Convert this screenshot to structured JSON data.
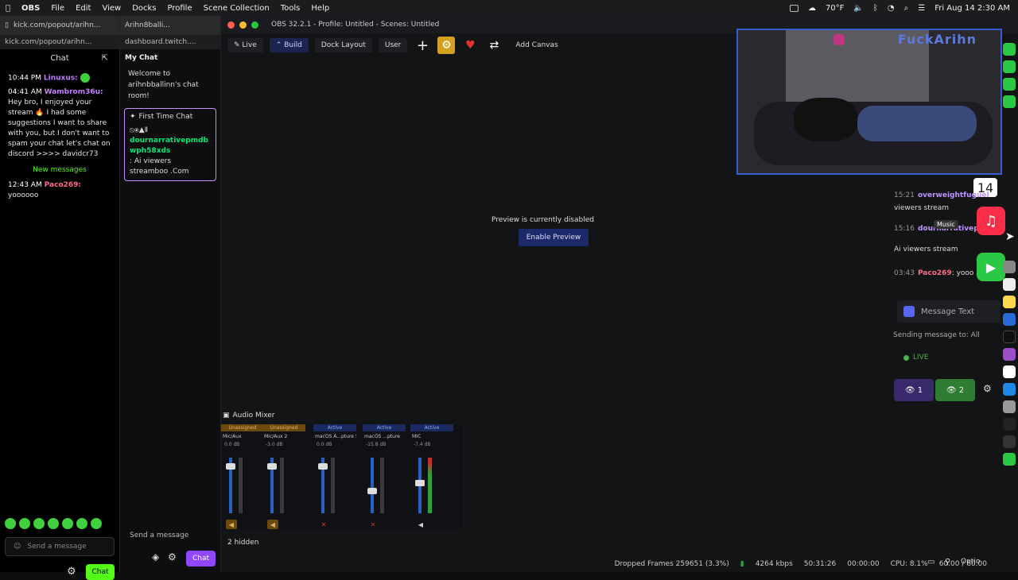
{
  "menubar": {
    "app": "OBS",
    "items": [
      "File",
      "Edit",
      "View",
      "Docks",
      "Profile",
      "Scene Collection",
      "Tools",
      "Help"
    ],
    "weather": "70°F",
    "datetime": "Fri Aug 14  2:30 AM"
  },
  "kick": {
    "tab": "kick.com/popout/arihn...",
    "address": "kick.com/popout/arihn...",
    "chat_title": "Chat",
    "messages": [
      {
        "time": "10:44 PM",
        "user": "Linuxus:",
        "text": ""
      },
      {
        "time": "04:41 AM",
        "user": "Wambrom36u:",
        "text": "Hey bro, I enjoyed your stream 🔥 I had some suggestions I want to share with you, but I don't want to spam your chat let's chat on discord >>>> davidcr73"
      },
      {
        "time": "12:43 AM",
        "user": "Paco269:",
        "text": "yoooooo"
      }
    ],
    "new_messages": "New messages",
    "input_placeholder": "Send a message",
    "chat_button": "Chat"
  },
  "twitch": {
    "tab": "Arihn8balli...",
    "address": "dashboard.twitch....",
    "title": "My Chat",
    "welcome": "Welcome to arihnbballinn's chat room!",
    "first_time": "First Time Chat",
    "ftc_symbols": "⦸⦿▲Ⅱ",
    "ftc_user": "dournarrativepmdbwph58xds",
    "ftc_text": ": Ai viewers streamboo .Com",
    "input_placeholder": "Send a message",
    "chat_button": "Chat"
  },
  "obs": {
    "title": "OBS 32.2.1 - Profile: Untitled - Scenes: Untitled",
    "toolbar": {
      "live": "Live",
      "build": "Build",
      "dock_layout": "Dock Layout",
      "user": "User",
      "add_canvas": "Add Canvas"
    },
    "preview_disabled": "Preview is currently disabled",
    "enable_preview": "Enable Preview",
    "cam_brand": "FuckArihn",
    "side_chat": [
      {
        "time": "15:21",
        "user": "overweightfuguel",
        "text": ""
      },
      {
        "time": "",
        "user": "",
        "text": "viewers stream"
      },
      {
        "time": "15:16",
        "user": "dournarrativep",
        "text": ""
      },
      {
        "time": "",
        "user": "",
        "text": "Ai viewers stream"
      },
      {
        "time": "03:43",
        "user": "Paco269",
        "text": ": yooo"
      }
    ],
    "music_label": "Music",
    "date_badge": "14",
    "message_placeholder": "Message Text",
    "sending_to": "Sending message to: All",
    "live_label": "LIVE",
    "viewers_a": "1",
    "viewers_b": "2",
    "mixer_title": "Audio Mixer",
    "channels": [
      {
        "status": "Unassigned",
        "name": "Mic/Aux",
        "db": "0.0 dB",
        "level": 0.85,
        "status_type": "un"
      },
      {
        "status": "Unassigned",
        "name": "Mic/Aux 2",
        "db": "-3.0 dB",
        "level": 0.85,
        "status_type": "un"
      },
      {
        "status": "Active",
        "name": "macOS A...pture 5",
        "db": "0.0 dB",
        "level": 0.85,
        "status_type": "ac"
      },
      {
        "status": "Active",
        "name": "macOS ...pture",
        "db": "-15.8 dB",
        "level": 0.4,
        "status_type": "ac"
      },
      {
        "status": "Active",
        "name": "MIC",
        "db": "-7.4 dB",
        "level": 0.55,
        "status_type": "ac"
      }
    ],
    "hidden": "2 hidden",
    "status": {
      "dropped": "Dropped Frames 259651 (3.3%)",
      "kbps": "4264 kbps",
      "time1": "50:31:26",
      "time2": "00:00:00",
      "cpu": "CPU: 8.1%",
      "fps": "60.00 / 60.00",
      "options": "Optio"
    }
  },
  "colors": {
    "kick_green": "#53fc18",
    "twitch_purple": "#9147ff",
    "obs_accent": "#1c2a6b"
  }
}
